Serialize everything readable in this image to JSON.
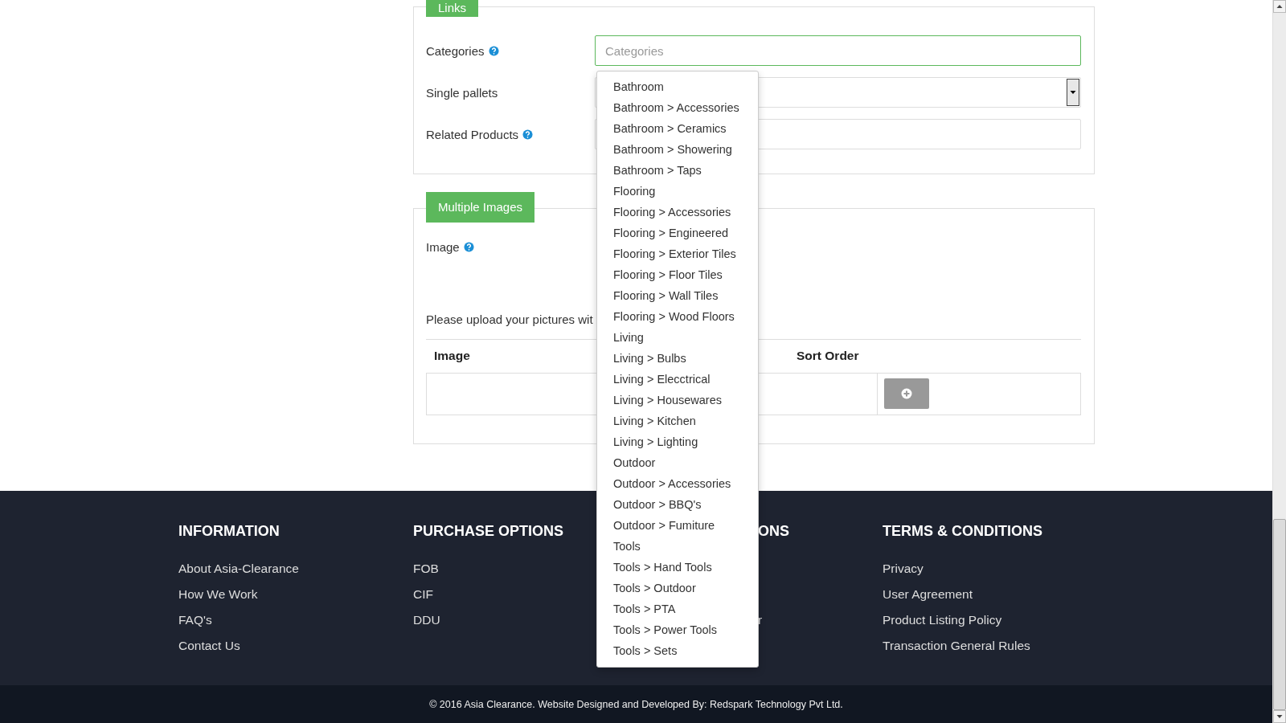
{
  "links_section": {
    "legend": "Links",
    "fields": [
      {
        "label": "Categories",
        "help": true,
        "kind": "text",
        "placeholder": "Categories",
        "focused": true
      },
      {
        "label": "Single pallets",
        "help": false,
        "kind": "select",
        "focused": false
      },
      {
        "label": "Related Products",
        "help": true,
        "kind": "text",
        "focused": false
      }
    ]
  },
  "images_section": {
    "legend": "Multiple Images",
    "image_label": "Image",
    "image_help": true,
    "note": "Please upload your pictures wit",
    "table": {
      "columns": [
        "Image",
        "Sort Order"
      ]
    }
  },
  "category_dropdown": {
    "items": [
      "Bathroom",
      "Bathroom > Accessories",
      "Bathroom > Ceramics",
      "Bathroom > Showering",
      "Bathroom > Taps",
      "Flooring",
      "Flooring > Accessories",
      "Flooring > Engineered",
      "Flooring > Exterior Tiles",
      "Flooring > Floor Tiles",
      "Flooring > Wall Tiles",
      "Flooring > Wood Floors",
      "Living",
      "Living > Bulbs",
      "Living > Elecctrical",
      "Living > Housewares",
      "Living > Kitchen",
      "Living > Lighting",
      "Outdoor",
      "Outdoor > Accessories",
      "Outdoor > BBQ's",
      "Outdoor > Fumiture",
      "Tools",
      "Tools > Hand Tools",
      "Tools > Outdoor",
      "Tools > PTA",
      "Tools > Power Tools",
      "Tools > Sets"
    ]
  },
  "footer": {
    "columns": [
      {
        "heading": "INFORMATION",
        "links": [
          "About Asia-Clearance",
          "How We Work",
          "FAQ's",
          "Contact Us"
        ]
      },
      {
        "heading": "PURCHASE OPTIONS",
        "links": [
          "FOB",
          "CIF",
          "DDU"
        ]
      },
      {
        "heading": "ONS",
        "links": [
          "r"
        ],
        "kind": "covered"
      },
      {
        "heading": "TERMS & CONDITIONS",
        "links": [
          "Privacy",
          "User Agreement",
          "Product Listing Policy",
          "Transaction General Rules"
        ]
      }
    ],
    "copyright": "© 2016 Asia Clearance. Website Designed and Developed By: Redspark Technology Pvt Ltd."
  }
}
